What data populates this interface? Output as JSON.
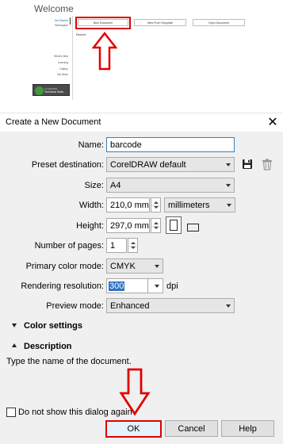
{
  "welcome": {
    "title": "Welcome",
    "nav_top": [
      "Get Started",
      "Workspace"
    ],
    "buttons": [
      "New Document",
      "New From Template",
      "Open Document"
    ],
    "recent_label": "Recent",
    "nav_bottom": [
      "What's New",
      "Learning",
      "Gallery",
      "Get More"
    ],
    "promo": {
      "line1": "CorelDRAW",
      "line2": "Technical Suite"
    }
  },
  "dialog": {
    "title": "Create a New Document",
    "fields": {
      "name_label": "Name:",
      "name_value": "barcode",
      "preset_label": "Preset destination:",
      "preset_value": "CorelDRAW default",
      "size_label": "Size:",
      "size_value": "A4",
      "width_label": "Width:",
      "width_value": "210,0 mm",
      "units_value": "millimeters",
      "height_label": "Height:",
      "height_value": "297,0 mm",
      "pages_label": "Number of pages:",
      "pages_value": "1",
      "color_label": "Primary color mode:",
      "color_value": "CMYK",
      "resolution_label": "Rendering resolution:",
      "resolution_value": "300",
      "resolution_unit": "dpi",
      "preview_label": "Preview mode:",
      "preview_value": "Enhanced"
    },
    "sections": {
      "color_settings": "Color settings",
      "description": "Description"
    },
    "description_text": "Type the name of the document.",
    "checkbox_label": "Do not show this dialog again",
    "buttons": {
      "ok": "OK",
      "cancel": "Cancel",
      "help": "Help"
    }
  },
  "annotation_color": "#e00000"
}
